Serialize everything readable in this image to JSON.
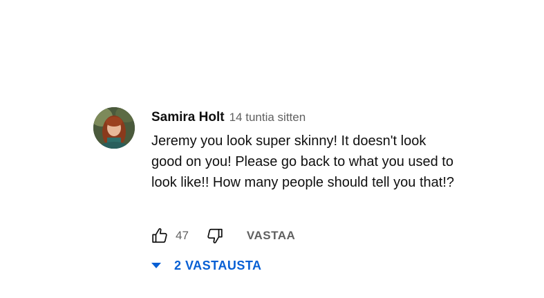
{
  "comment": {
    "author": "Samira Holt",
    "timestamp": "14 tuntia sitten",
    "text": "Jeremy you look super skinny! It doesn't look good on you! Please go back to what you used to look like!! How many people should tell you that!?",
    "like_count": "47",
    "reply_label": "VASTAA",
    "replies_label": "2 VASTAUSTA"
  },
  "icons": {
    "avatar": "user-avatar-photo",
    "like": "thumbs-up-icon",
    "dislike": "thumbs-down-icon",
    "expand": "caret-down-icon"
  },
  "colors": {
    "text_primary": "#0f0f0f",
    "text_secondary": "#606060",
    "link_blue": "#065fd4"
  }
}
